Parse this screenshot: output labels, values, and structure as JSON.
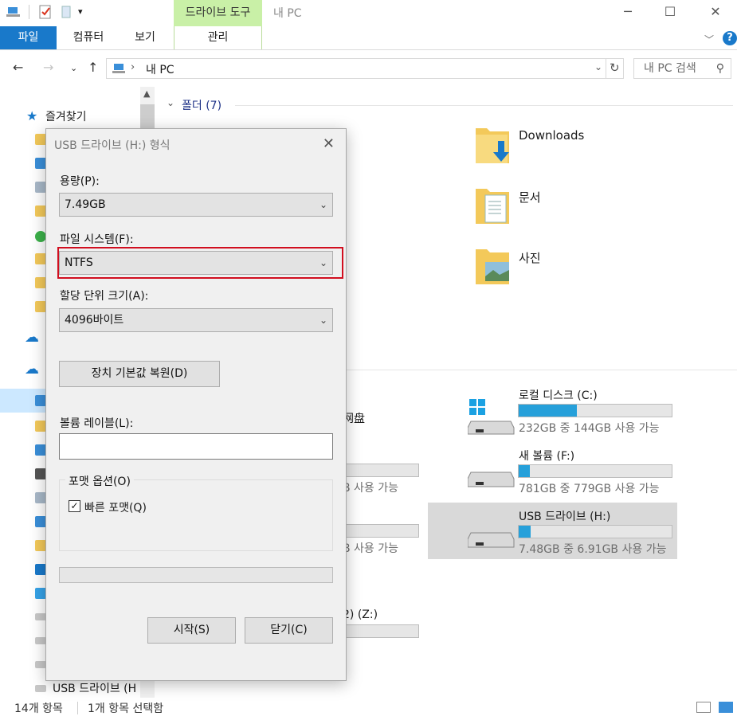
{
  "window": {
    "title": "내 PC",
    "context_tab_header": "드라이브 도구",
    "minimize": "─",
    "maximize": "☐",
    "close": "✕"
  },
  "ribbon": {
    "tabs": [
      "파일",
      "컴퓨터",
      "보기",
      "관리"
    ],
    "help": "?"
  },
  "address": {
    "path": "내 PC",
    "search_placeholder": "내 PC 검색"
  },
  "nav": {
    "quick_access": "즐겨찾기",
    "bottom_item": "USB 드라이브 (H"
  },
  "content": {
    "folders_header": "폴더 (7)",
    "folders": [
      "Downloads",
      "문서",
      "사진"
    ],
    "partial_drives": {
      "left_label_1": "网盘",
      "left_sub_2": "B 사용 가능",
      "left_sub_3": "B 사용 가능",
      "left_label_z": "2) (Z:)"
    },
    "drives": [
      {
        "name": "로컬 디스크 (C:)",
        "free": "232GB 중 144GB 사용 가능",
        "used_fraction": 0.38
      },
      {
        "name": "새 볼륨 (F:)",
        "free": "781GB 중 779GB 사용 가능",
        "used_fraction": 0.003
      },
      {
        "name": "USB 드라이브 (H:)",
        "free": "7.48GB 중 6.91GB 사용 가능",
        "used_fraction": 0.076
      }
    ]
  },
  "status": {
    "count": "14개 항목",
    "selected": "1개 항목 선택함"
  },
  "dialog": {
    "title": "USB 드라이브 (H:) 형식",
    "capacity_label": "용량(P):",
    "capacity_value": "7.49GB",
    "fs_label": "파일 시스템(F):",
    "fs_value": "NTFS",
    "alloc_label": "할당 단위 크기(A):",
    "alloc_value": "4096바이트",
    "restore_btn": "장치 기본값 복원(D)",
    "volume_label": "볼륨 레이블(L):",
    "volume_value": "",
    "options_title": "포맷 옵션(O)",
    "quick_format": "빠른 포맷(Q)",
    "quick_format_checked": true,
    "start_btn": "시작(S)",
    "close_btn": "닫기(C)"
  },
  "colors": {
    "accent": "#1979ca",
    "context_tab": "#c9f0a7",
    "progress_fill": "#26a0da",
    "highlight_border": "#d10e1f"
  }
}
